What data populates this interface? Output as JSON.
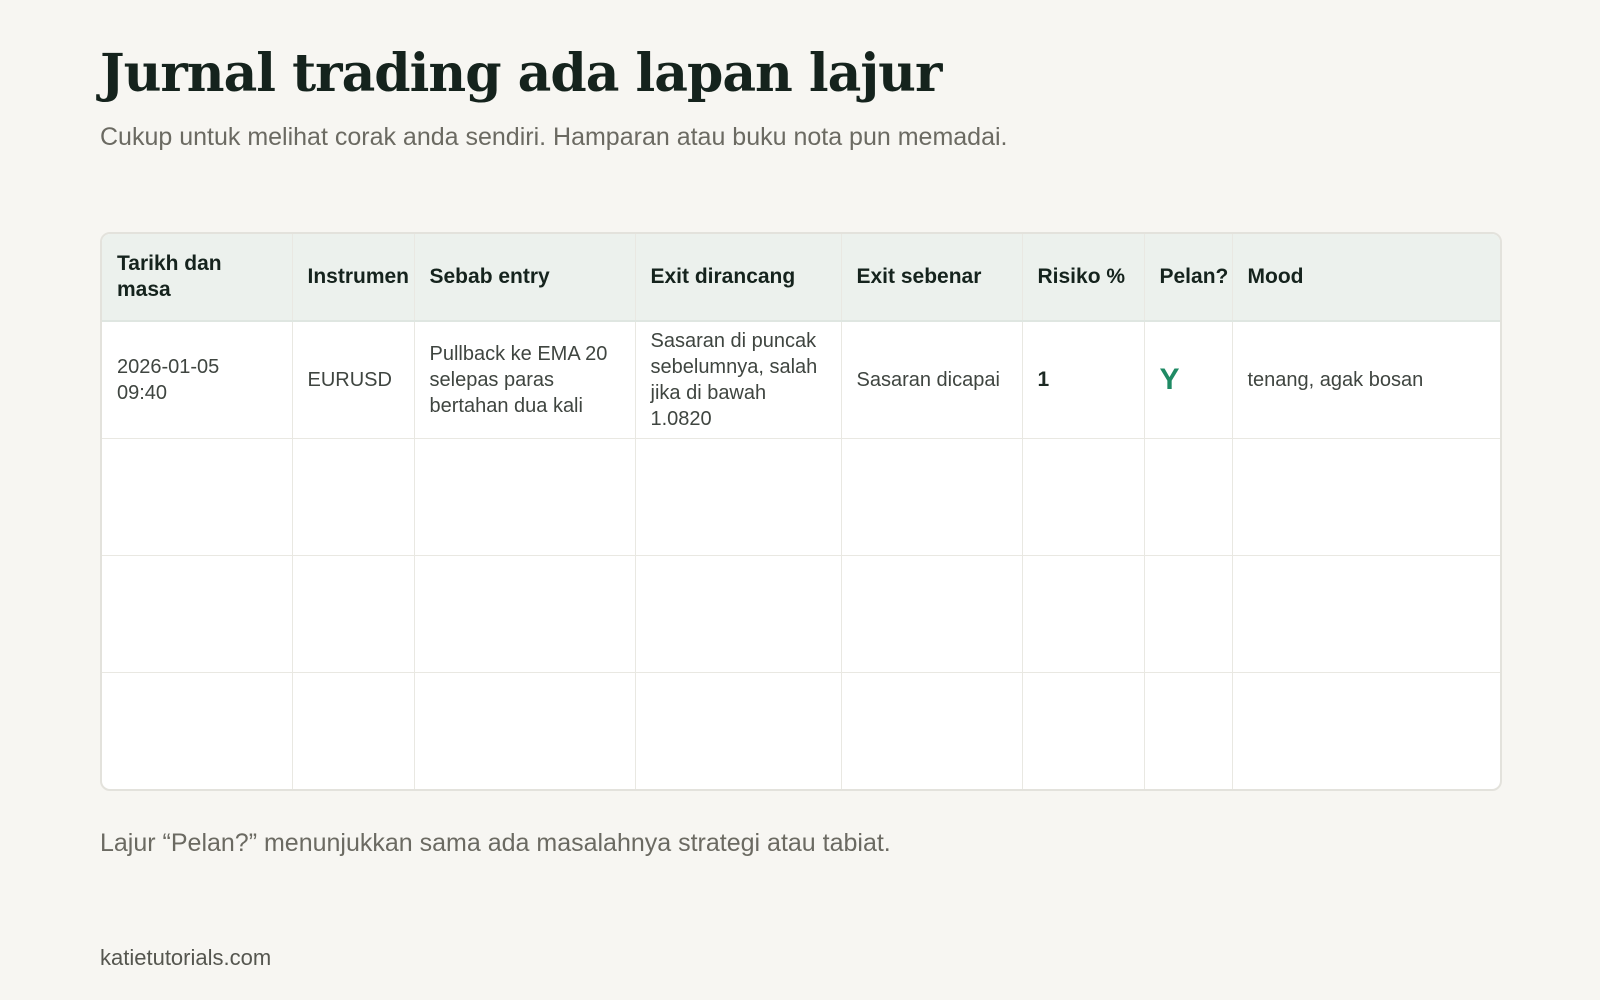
{
  "title": "Jurnal trading ada lapan lajur",
  "subtitle": "Cukup untuk melihat corak anda sendiri. Hamparan atau buku nota pun memadai.",
  "table": {
    "headers": [
      "Tarikh dan masa",
      "Instrumen",
      "Sebab entry",
      "Exit dirancang",
      "Exit sebenar",
      "Risiko %",
      "Pelan?",
      "Mood"
    ],
    "rows": [
      [
        "2026-01-05 09:40",
        "EURUSD",
        "Pullback ke EMA 20 selepas paras bertahan dua kali",
        "Sasaran di puncak sebelumnya, salah jika di bawah 1.0820",
        "Sasaran dicapai",
        "1",
        "Y",
        "tenang, agak bosan"
      ],
      [
        "",
        "",
        "",
        "",
        "",
        "",
        "",
        ""
      ],
      [
        "",
        "",
        "",
        "",
        "",
        "",
        "",
        ""
      ],
      [
        "",
        "",
        "",
        "",
        "",
        "",
        "",
        ""
      ]
    ]
  },
  "note": "Lajur “Pelan?” menunjukkan sama ada masalahnya strategi atau tabiat.",
  "footer": "katietutorials.com",
  "colors": {
    "background": "#f7f6f2",
    "header_background": "#ecf1ed",
    "plan_yes": "#1f8a64"
  }
}
